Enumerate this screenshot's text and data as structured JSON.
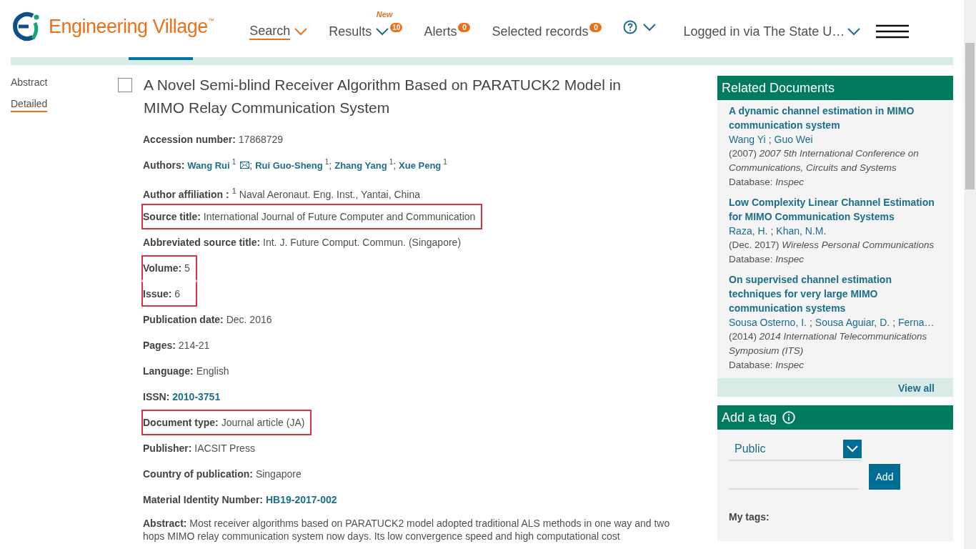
{
  "brand": {
    "name": "Engineering Village",
    "trademark": "™"
  },
  "nav": [
    {
      "label": "Search",
      "selected": true,
      "chevron": true
    },
    {
      "label": "Results",
      "selected": false,
      "chevron": true,
      "flag": "New",
      "badge": "10"
    },
    {
      "label": "Alerts",
      "selected": false,
      "chevron": false,
      "badge": "0"
    },
    {
      "label": "Selected records",
      "selected": false,
      "chevron": false,
      "badge": "0"
    }
  ],
  "account": {
    "label": "Logged in via The State U…"
  },
  "side_nav": [
    {
      "label": "Abstract",
      "selected": false
    },
    {
      "label": "Detailed",
      "selected": true
    }
  ],
  "record": {
    "checked": false,
    "title": "A Novel Semi-blind Receiver Algorithm Based on PARATUCK2 Model in MIMO Relay Communication System",
    "fields": [
      {
        "kind": "text",
        "label": "Accession number:",
        "value": "17868729",
        "highlighted": false
      },
      {
        "kind": "authors",
        "label": "Authors:",
        "highlighted": false,
        "separator": ";",
        "authors": [
          {
            "name": "Wang Rui",
            "mark": "1",
            "email": true
          },
          {
            "name": "Rui Guo-Sheng",
            "mark": "1",
            "email": false
          },
          {
            "name": "Zhang Yang",
            "mark": "1",
            "email": false
          },
          {
            "name": "Xue Peng",
            "mark": "1",
            "email": false
          }
        ]
      },
      {
        "kind": "text",
        "label": "Author affiliation :",
        "value": "$^{1}$ Naval Aeronaut. Eng. Inst., Yantai, China",
        "highlighted": false
      },
      {
        "kind": "text",
        "label": "Source title:",
        "value": "International Journal of Future Computer and Communication",
        "highlighted": true
      },
      {
        "kind": "text",
        "label": "Abbreviated source title:",
        "value": "Int. J. Future Comput. Commun. (Singapore)",
        "highlighted": false
      },
      {
        "kind": "text",
        "label": "Volume:",
        "value": "5",
        "highlighted": true
      },
      {
        "kind": "text",
        "label": "Issue:",
        "value": "6",
        "highlighted": true
      },
      {
        "kind": "text",
        "label": "Publication date:",
        "value": "Dec. 2016",
        "highlighted": false
      },
      {
        "kind": "text",
        "label": "Pages:",
        "value": "214-21",
        "highlighted": false
      },
      {
        "kind": "text",
        "label": "Language:",
        "value": "English",
        "highlighted": false
      },
      {
        "kind": "link",
        "label": "ISSN:",
        "value": "2010-3751",
        "highlighted": false
      },
      {
        "kind": "text",
        "label": "Document type:",
        "value": "Journal article (JA)",
        "highlighted": true
      },
      {
        "kind": "text",
        "label": "Publisher:",
        "value": "IACSIT Press",
        "highlighted": false
      },
      {
        "kind": "text",
        "label": "Country of publication:",
        "value": "Singapore",
        "highlighted": false
      },
      {
        "kind": "link",
        "label": "Material Identity Number:",
        "value": "HB19-2017-002",
        "highlighted": false
      },
      {
        "kind": "paragraph",
        "label": "Abstract:",
        "value": "Most receiver algorithms based on PARATUCK2 model adopted traditional ALS methods in one way and two hops MIMO relay communication system now days. Its low convergence speed and high computational cost",
        "highlighted": false
      }
    ]
  },
  "related": {
    "title": "Related Documents",
    "view_all": "View all",
    "separator": ";",
    "items": [
      {
        "title": "A dynamic channel estimation in MIMO communication system",
        "authors": [
          "Wang Yi",
          "Guo Wei"
        ],
        "source": "(2007) *2007 5th International Conference on Communications, Circuits and Systems*",
        "database": "Database: *Inspec*"
      },
      {
        "title": "Low Complexity Linear Channel Estimation for MIMO Communication Systems",
        "authors": [
          "Raza, H.",
          "Khan, N.M."
        ],
        "source": "(Dec. 2017) *Wireless Personal Communications*",
        "database": "Database: *Inspec*"
      },
      {
        "title": "On supervised channel estimation techniques for very large MIMO communication systems",
        "authors": [
          "Sousa Osterno, I.",
          "Sousa Aguiar, D.",
          "Ferna…"
        ],
        "source": "(2014) *2014 International Telecommunications Symposium (ITS)*",
        "database": "Database: *Inspec*"
      }
    ]
  },
  "tags": {
    "title": "Add a tag",
    "visibility": "Public",
    "add_button": "Add",
    "my_tags": "My tags:"
  }
}
